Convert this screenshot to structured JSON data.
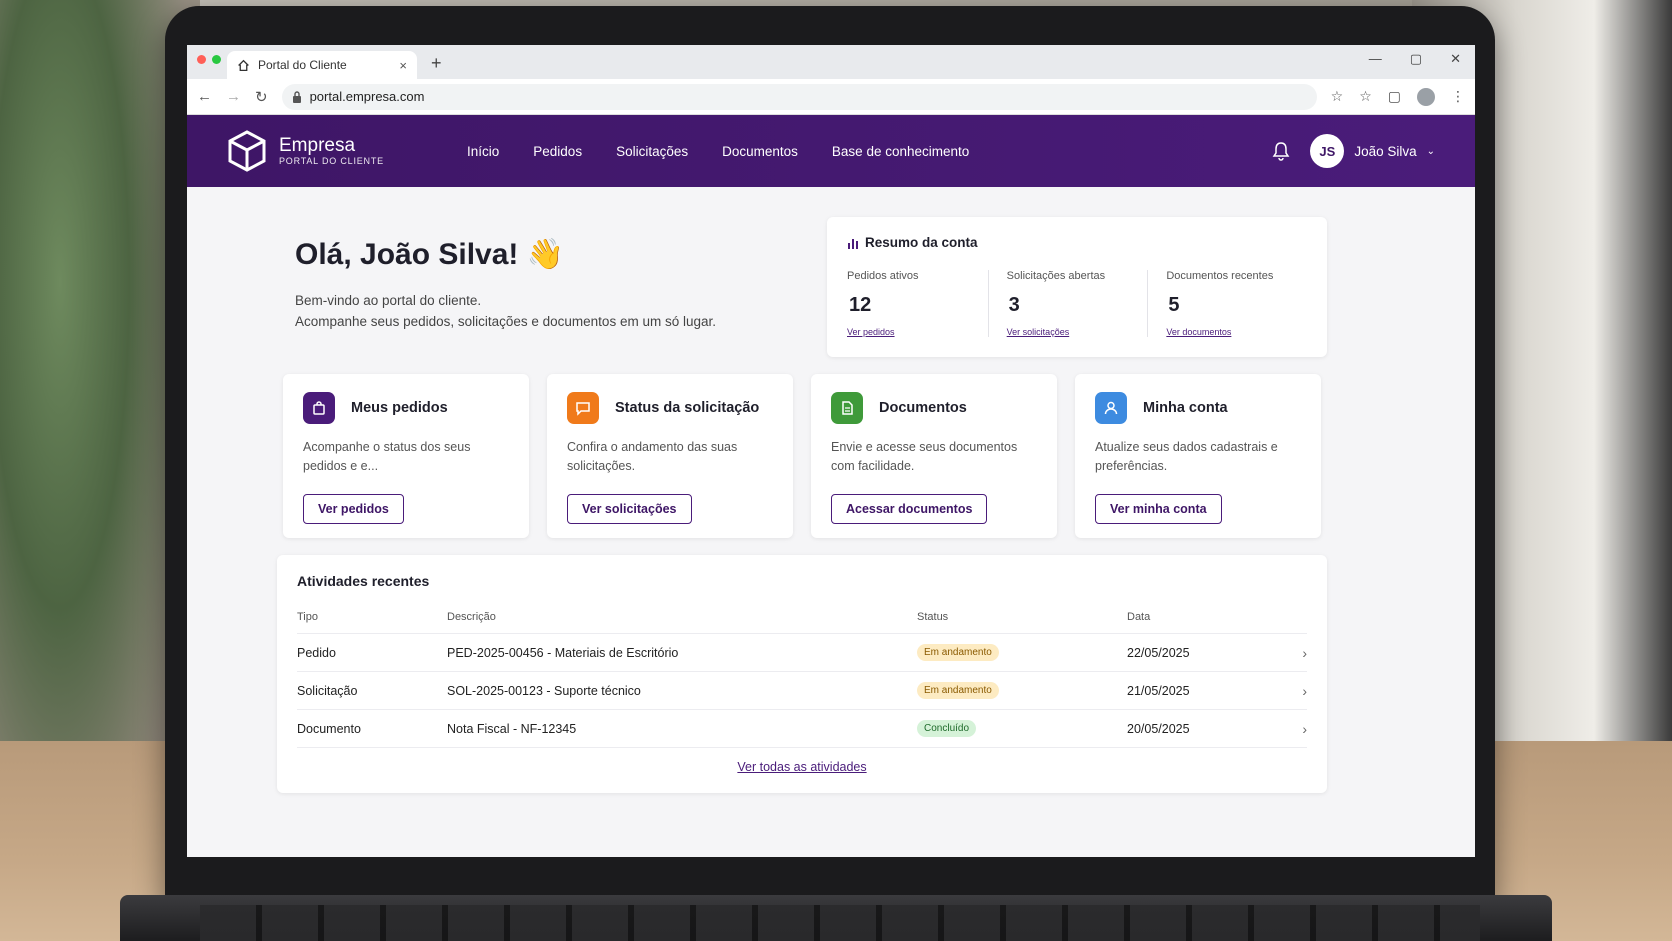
{
  "browser": {
    "tab_title": "Portal do Cliente",
    "tab_close": "×",
    "new_tab": "+",
    "url": "portal.empresa.com",
    "window_controls": [
      "—",
      "▢",
      "✕"
    ]
  },
  "header": {
    "brand_name": "Empresa",
    "brand_sub": "PORTAL DO CLIENTE",
    "nav": [
      "Início",
      "Pedidos",
      "Solicitações",
      "Documentos",
      "Base de conhecimento"
    ],
    "avatar_initials": "JS",
    "user_name": "João Silva"
  },
  "hero": {
    "title": "Olá, João Silva! 👋",
    "line1": "Bem-vindo ao portal do cliente.",
    "line2": "Acompanhe seus pedidos, solicitações e documentos em um só lugar."
  },
  "summary": {
    "title": "Resumo da conta",
    "stats": [
      {
        "label": "Pedidos ativos",
        "value": "12",
        "link": "Ver pedidos"
      },
      {
        "label": "Solicitações abertas",
        "value": "3",
        "link": "Ver solicitações"
      },
      {
        "label": "Documentos recentes",
        "value": "5",
        "link": "Ver documentos"
      }
    ]
  },
  "cards": [
    {
      "title": "Meus pedidos",
      "desc": "Acompanhe o status dos seus pedidos e e...",
      "button": "Ver pedidos",
      "color": "#4a1c7a"
    },
    {
      "title": "Status da solicitação",
      "desc": "Confira o andamento das suas solicitações.",
      "button": "Ver solicitações",
      "color": "#f07a1a"
    },
    {
      "title": "Documentos",
      "desc": "Envie e acesse seus documentos com facilidade.",
      "button": "Acessar documentos",
      "color": "#3f9a3a"
    },
    {
      "title": "Minha conta",
      "desc": "Atualize seus dados cadastrais e preferências.",
      "button": "Ver minha conta",
      "color": "#3d8be0"
    }
  ],
  "activity": {
    "title": "Atividades recentes",
    "columns": [
      "Tipo",
      "Descrição",
      "Status",
      "Data"
    ],
    "rows": [
      {
        "type": "Pedido",
        "desc": "PED-2025-00456 - Materiais de Escritório",
        "status": "Em andamento",
        "date": "22/05/2025"
      },
      {
        "type": "Solicitação",
        "desc": "SOL-2025-00123 - Suporte técnico",
        "status": "Em andamento",
        "date": "21/05/2025"
      },
      {
        "type": "Documento",
        "desc": "Nota Fiscal - NF-12345",
        "status": "Concluído",
        "date": "20/05/2025"
      }
    ],
    "view_all": "Ver todas as atividades"
  }
}
